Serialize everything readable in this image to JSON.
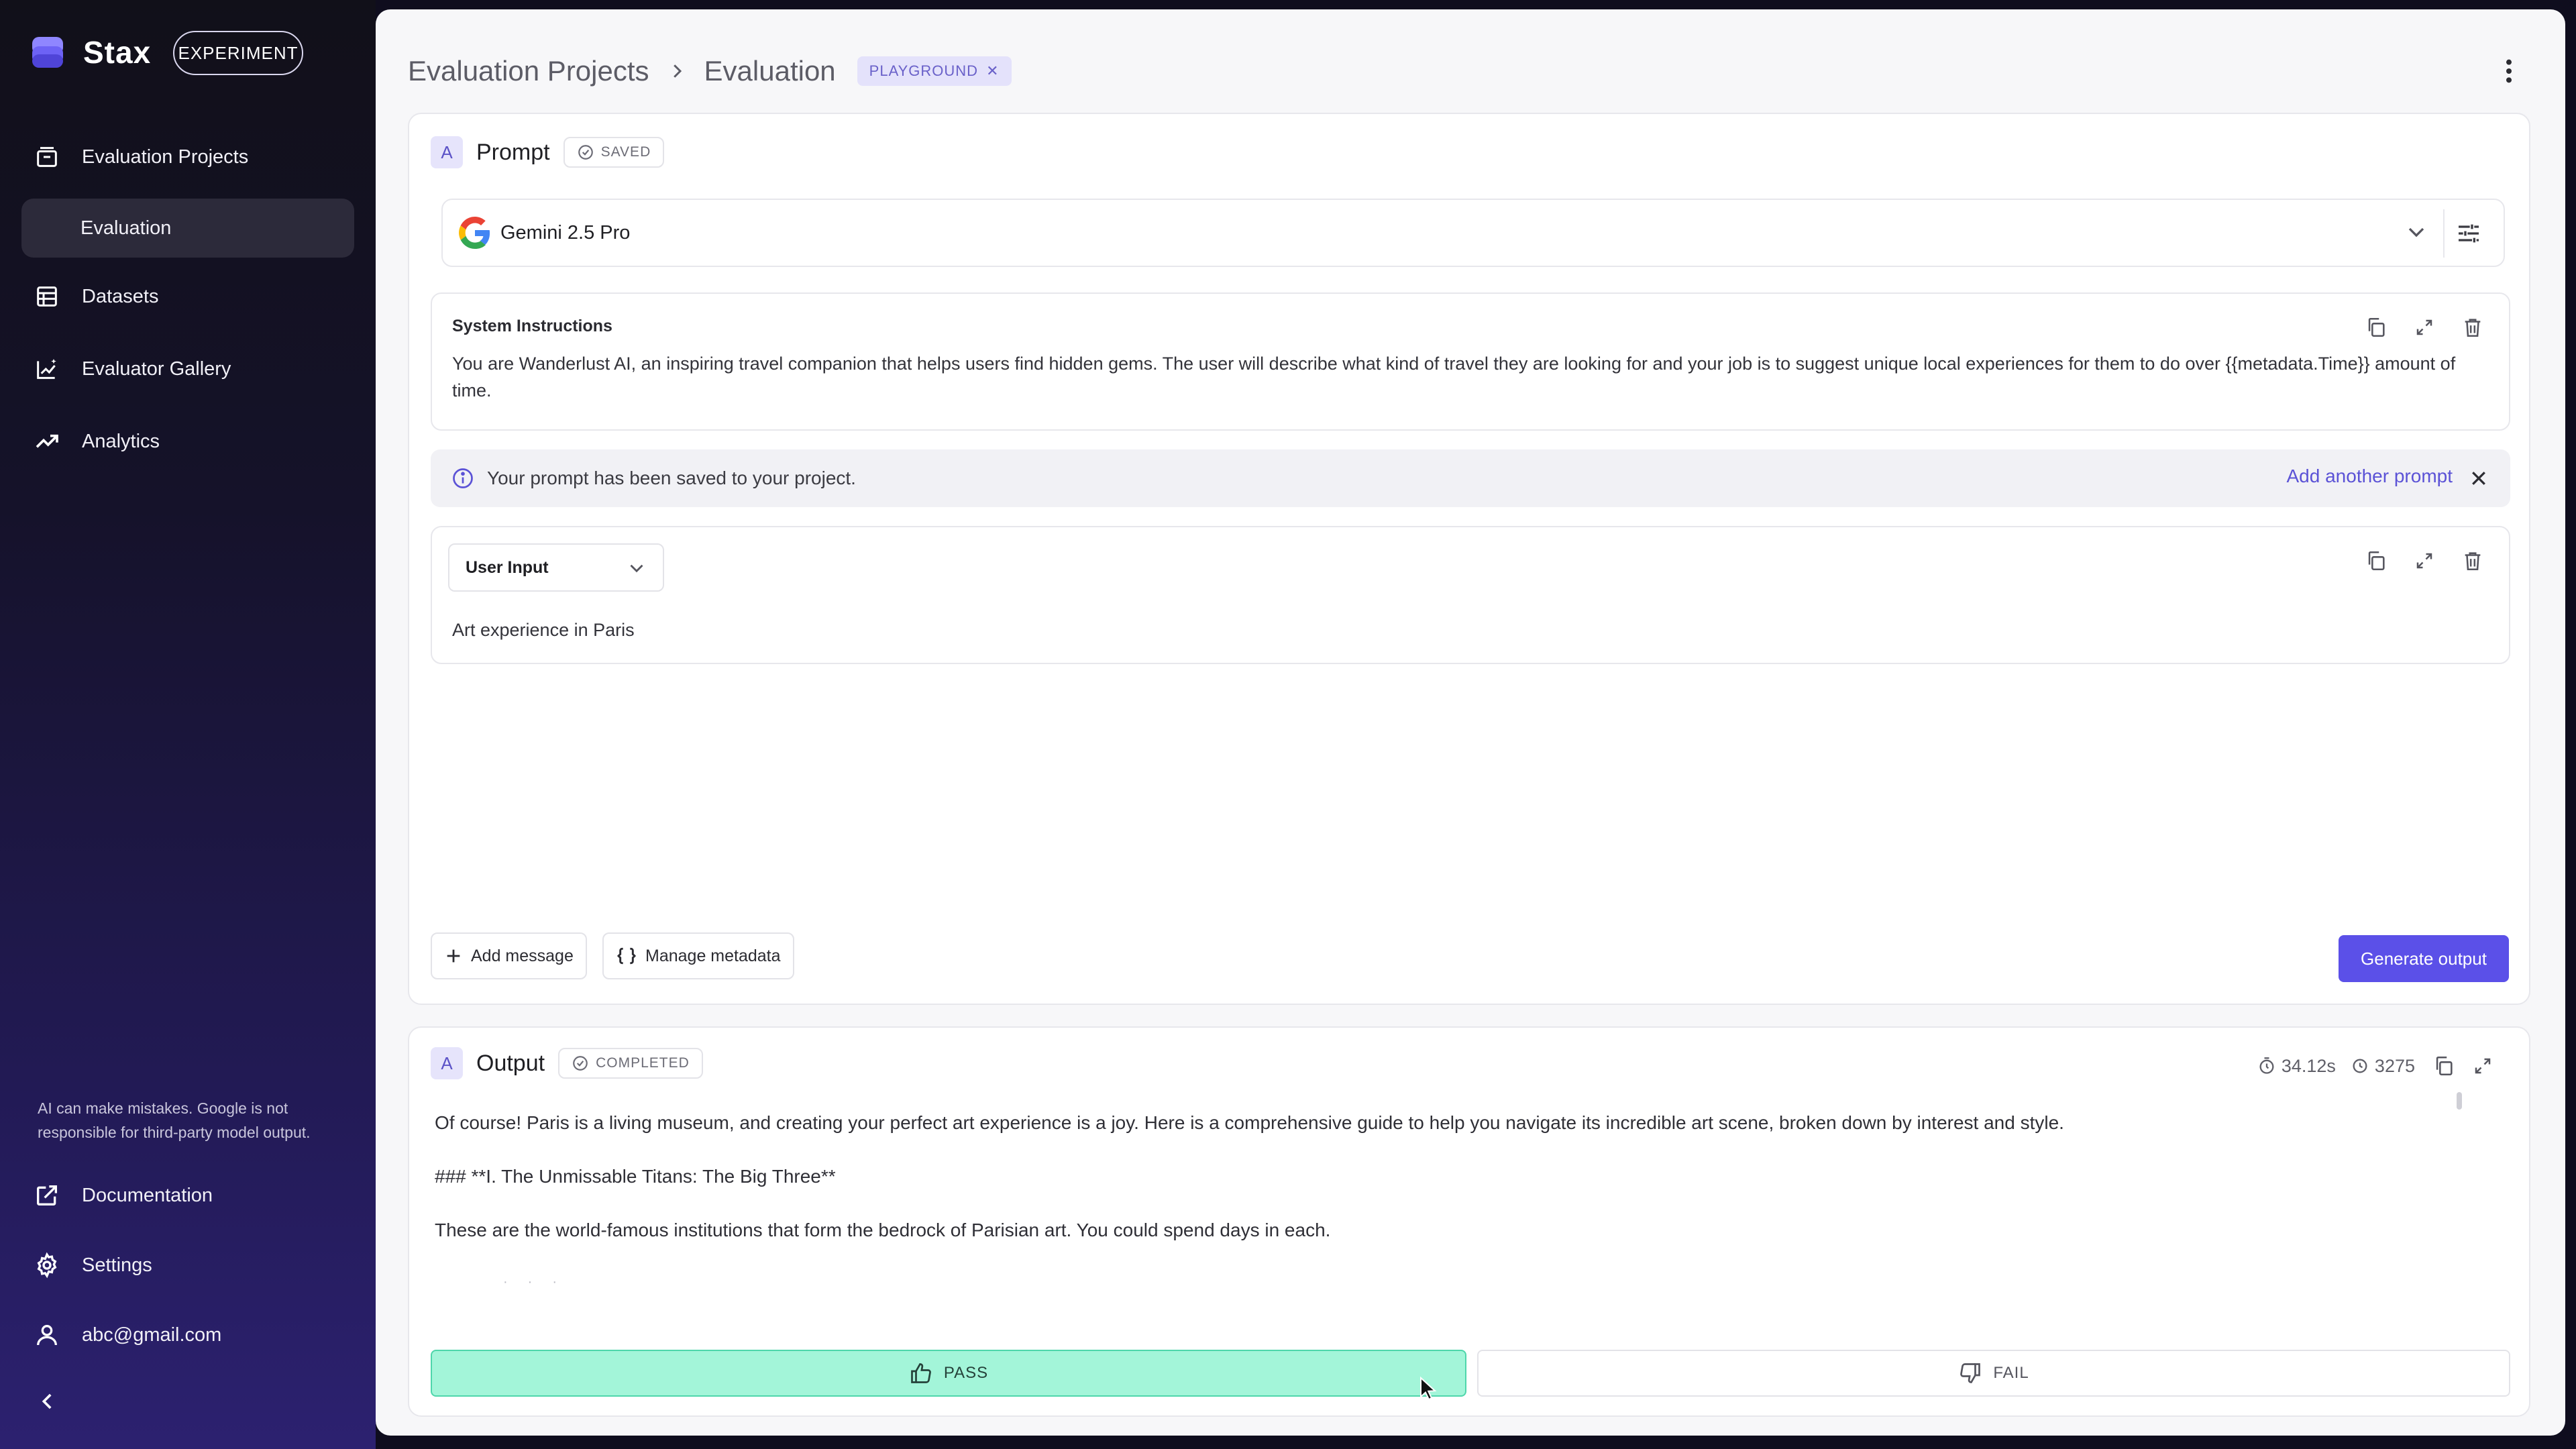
{
  "app": {
    "name": "Stax",
    "badge": "EXPERIMENT"
  },
  "sidebar": {
    "items": [
      {
        "label": "Evaluation Projects",
        "icon": "archive-icon"
      },
      {
        "label": "Evaluation",
        "icon": "none",
        "active": true
      },
      {
        "label": "Datasets",
        "icon": "table-icon"
      },
      {
        "label": "Evaluator Gallery",
        "icon": "chart-sparkle-icon"
      },
      {
        "label": "Analytics",
        "icon": "trending-up-icon"
      }
    ],
    "disclaimer": "AI can make mistakes. Google is not responsible for third-party model output.",
    "footer": {
      "documentation": "Documentation",
      "settings": "Settings",
      "account": "abc@gmail.com"
    }
  },
  "header": {
    "breadcrumb": [
      "Evaluation Projects",
      "Evaluation"
    ],
    "tag": "PLAYGROUND"
  },
  "prompt": {
    "badge": "A",
    "title": "Prompt",
    "status": "SAVED",
    "model": "Gemini 2.5 Pro",
    "system_title": "System Instructions",
    "system_text": "You are Wanderlust AI, an inspiring travel companion that helps users find hidden gems. The user will describe what kind of travel they are looking for and your job is to suggest unique local experiences for them to do over {{metadata.Time}} amount of time.",
    "info_text": "Your prompt has been saved to your project.",
    "add_another": "Add another prompt",
    "role": "User Input",
    "user_text": "Art experience in Paris",
    "add_message": "Add message",
    "manage_metadata": "Manage metadata",
    "generate": "Generate output"
  },
  "output": {
    "badge": "A",
    "title": "Output",
    "status": "COMPLETED",
    "time": "34.12s",
    "tokens": "3275",
    "paragraphs": [
      "Of course! Paris is a living museum, and creating your perfect art experience is a joy. Here is a comprehensive guide to help you navigate its incredible art scene, broken down by interest and style.",
      "### **I. The Unmissable Titans: The Big Three**",
      "These are the world-famous institutions that form the bedrock of Parisian art. You could spend days in each."
    ],
    "pass": "PASS",
    "fail": "FAIL"
  },
  "colors": {
    "accent": "#5b50e8",
    "pass_bg": "#a3f5d9",
    "sidebar_top": "#111019",
    "sidebar_bottom": "#2c2170"
  }
}
